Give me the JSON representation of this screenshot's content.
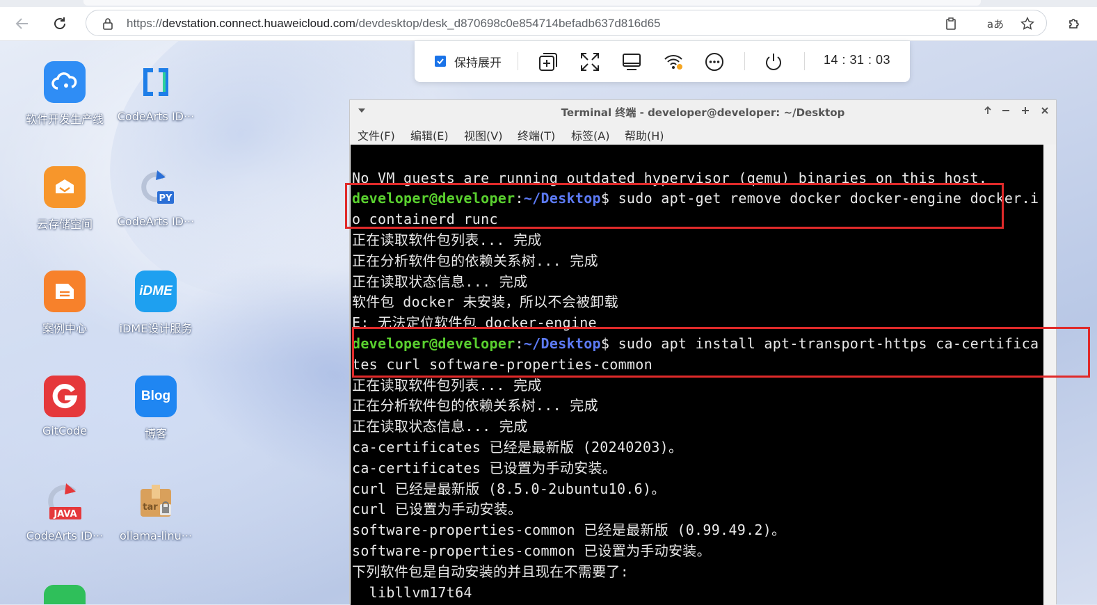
{
  "browser": {
    "url_prefix": "https://",
    "url_host": "devstation.connect.huaweicloud.com",
    "url_path": "/devdesktop/desk_d870698c0e854714befadb637d816d65"
  },
  "desktop": {
    "icons": [
      {
        "label": "软件开发生产线",
        "icon": "cloud-devops-icon",
        "color": "#2f8df5"
      },
      {
        "label": "CodeArts ID···",
        "icon": "codearts-ide-icon",
        "color": "#1e7ee8"
      },
      {
        "label": "云存储空间",
        "icon": "cloud-storage-icon",
        "color": "#f7962b"
      },
      {
        "label": "CodeArts ID···",
        "icon": "codearts-python-icon",
        "color": "#2b6fd6"
      },
      {
        "label": "案例中心",
        "icon": "case-center-icon",
        "color": "#f7812b"
      },
      {
        "label": "iDME设计服务",
        "icon": "idme-icon",
        "color": "#1ea0f0"
      },
      {
        "label": "GitCode",
        "icon": "gitcode-icon",
        "color": "#e5383b"
      },
      {
        "label": "博客",
        "icon": "blog-icon",
        "color": "#1f86f2"
      },
      {
        "label": "CodeArts ID···",
        "icon": "codearts-java-icon",
        "color": "#e5383b"
      },
      {
        "label": "ollama-linu···",
        "icon": "tar-archive-icon",
        "color": "#d9a05b"
      }
    ],
    "java_badge": "JAVA",
    "py_badge": "PY",
    "tar_badge": "tar",
    "blog_text": "Blog",
    "idme_text": "iDME"
  },
  "toolbar": {
    "keep_expanded": "保持展开",
    "clock": "14 : 31 : 03"
  },
  "terminal": {
    "title": "Terminal 终端 - developer@developer: ~/Desktop",
    "menu": [
      "文件(F)",
      "编辑(E)",
      "视图(V)",
      "终端(T)",
      "标签(A)",
      "帮助(H)"
    ],
    "prompt_user": "developer@developer",
    "prompt_path": "~/Desktop",
    "lines": {
      "l0": "No VM guests are running outdated hypervisor (qemu) binaries on this host.",
      "cmd1": "$ sudo apt-get remove docker docker-engine docker.i",
      "l2": "o containerd runc",
      "l3": "正在读取软件包列表... 完成",
      "l4": "正在分析软件包的依赖关系树... 完成",
      "l5": "正在读取状态信息... 完成",
      "l6": "软件包 docker 未安装，所以不会被卸载",
      "l7": "E: 无法定位软件包 docker-engine",
      "cmd2": "$ sudo apt install apt-transport-https ca-certifica",
      "l9": "tes curl software-properties-common",
      "l10": "正在读取软件包列表... 完成",
      "l11": "正在分析软件包的依赖关系树... 完成",
      "l12": "正在读取状态信息... 完成",
      "l13": "ca-certificates 已经是最新版 (20240203)。",
      "l14": "ca-certificates 已设置为手动安装。",
      "l15": "curl 已经是最新版 (8.5.0-2ubuntu10.6)。",
      "l16": "curl 已设置为手动安装。",
      "l17": "software-properties-common 已经是最新版 (0.99.49.2)。",
      "l18": "software-properties-common 已设置为手动安装。",
      "l19": "下列软件包是自动安装的并且现在不需要了:",
      "l20": "  libllvm17t64"
    }
  },
  "colors": {
    "prompt_user": "#5ad12f",
    "prompt_path": "#5d7bf7",
    "highlight": "#e02a2a"
  }
}
